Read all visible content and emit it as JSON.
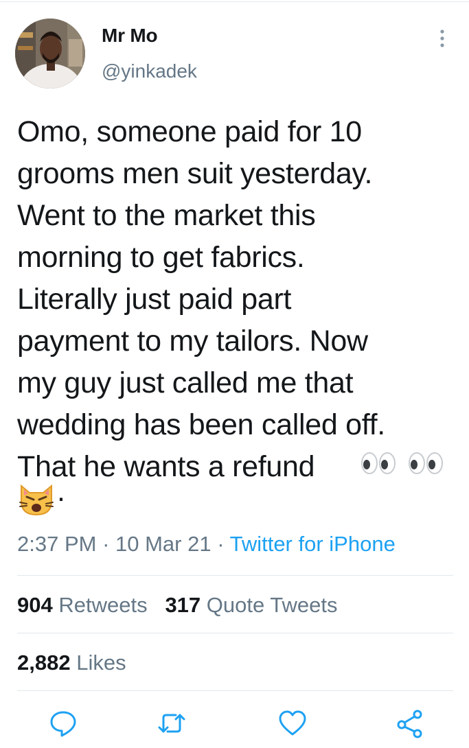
{
  "user": {
    "display_name": "Mr Mo",
    "handle": "@yinkadek"
  },
  "tweet": {
    "text": "Omo, someone paid for 10\ngrooms men suit yesterday.\nWent to the market this\nmorning to get fabrics.\nLiterally just paid part\npayment to my tailors. Now\nmy guy just called me that\nwedding has been called off.\nThat he wants a refund",
    "trailing": ".",
    "emojis": [
      "eyes",
      "eyes",
      "weary-cat-face"
    ]
  },
  "meta": {
    "time": "2:37 PM",
    "sep1": " · ",
    "date": "10 Mar 21",
    "sep2": " · ",
    "source": "Twitter for iPhone"
  },
  "stats": {
    "retweets_count": "904",
    "retweets_label": "Retweets",
    "quote_count": "317",
    "quote_label": "Quote Tweets",
    "likes_count": "2,882",
    "likes_label": "Likes"
  },
  "icons": {
    "more": "more-vertical-icon",
    "reply": "reply-icon",
    "retweet": "retweet-icon",
    "like": "heart-icon",
    "share": "share-icon"
  },
  "colors": {
    "accent": "#1da1f2",
    "secondary_text": "#657786",
    "icon": "#1da1f2"
  }
}
